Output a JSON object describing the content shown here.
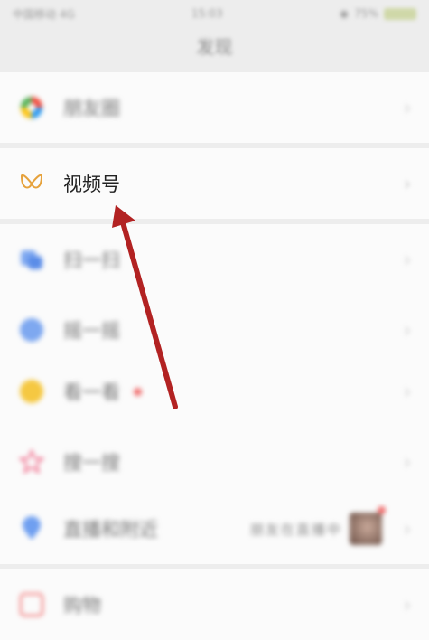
{
  "status_bar": {
    "carrier": "中国移动 4G",
    "time": "15:03",
    "battery": "75%"
  },
  "nav": {
    "title": "发现"
  },
  "rows": {
    "moments": {
      "label": "朋友圈",
      "icon": "moments-icon"
    },
    "channels": {
      "label": "视频号",
      "icon": "channels-icon"
    },
    "scan": {
      "label": "扫一扫",
      "icon": "scan-icon"
    },
    "shake": {
      "label": "摇一摇",
      "icon": "shake-icon"
    },
    "top_stories": {
      "label": "看一看",
      "icon": "top-stories-icon"
    },
    "search": {
      "label": "搜一搜",
      "icon": "search-icon"
    },
    "nearby": {
      "label": "直播和附近",
      "icon": "nearby-icon",
      "right_text": "朋友在直播中"
    },
    "shopping": {
      "label": "购物",
      "icon": "shopping-icon"
    }
  },
  "chevron": "›",
  "colors": {
    "arrow": "#b22222",
    "channels_icon": "#e6a23c"
  }
}
